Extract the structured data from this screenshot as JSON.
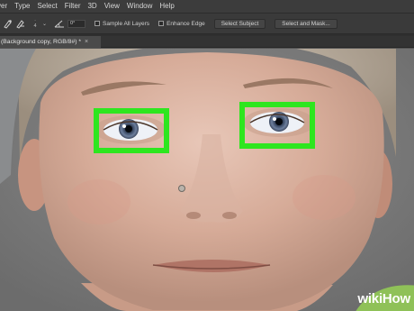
{
  "menubar": {
    "items": [
      {
        "label": "yer"
      },
      {
        "label": "Type"
      },
      {
        "label": "Select"
      },
      {
        "label": "Filter"
      },
      {
        "label": "3D"
      },
      {
        "label": "View"
      },
      {
        "label": "Window"
      },
      {
        "label": "Help"
      }
    ]
  },
  "options": {
    "brush_size": "4",
    "angle_value": "0°",
    "sample_all_layers_label": "Sample All Layers",
    "sample_all_layers_checked": false,
    "enhance_edge_label": "Enhance Edge",
    "enhance_edge_checked": false,
    "select_subject_label": "Select Subject",
    "select_mask_label": "Select and Mask..."
  },
  "document": {
    "tab_title": "(Background copy, RGB/8#) *",
    "tab_close": "×"
  },
  "watermark": {
    "part1": "wiki",
    "part2": "How",
    "color": "#8fc158"
  },
  "colors": {
    "selection": "#2ee61f",
    "ui_dark": "#3a3a3a"
  }
}
